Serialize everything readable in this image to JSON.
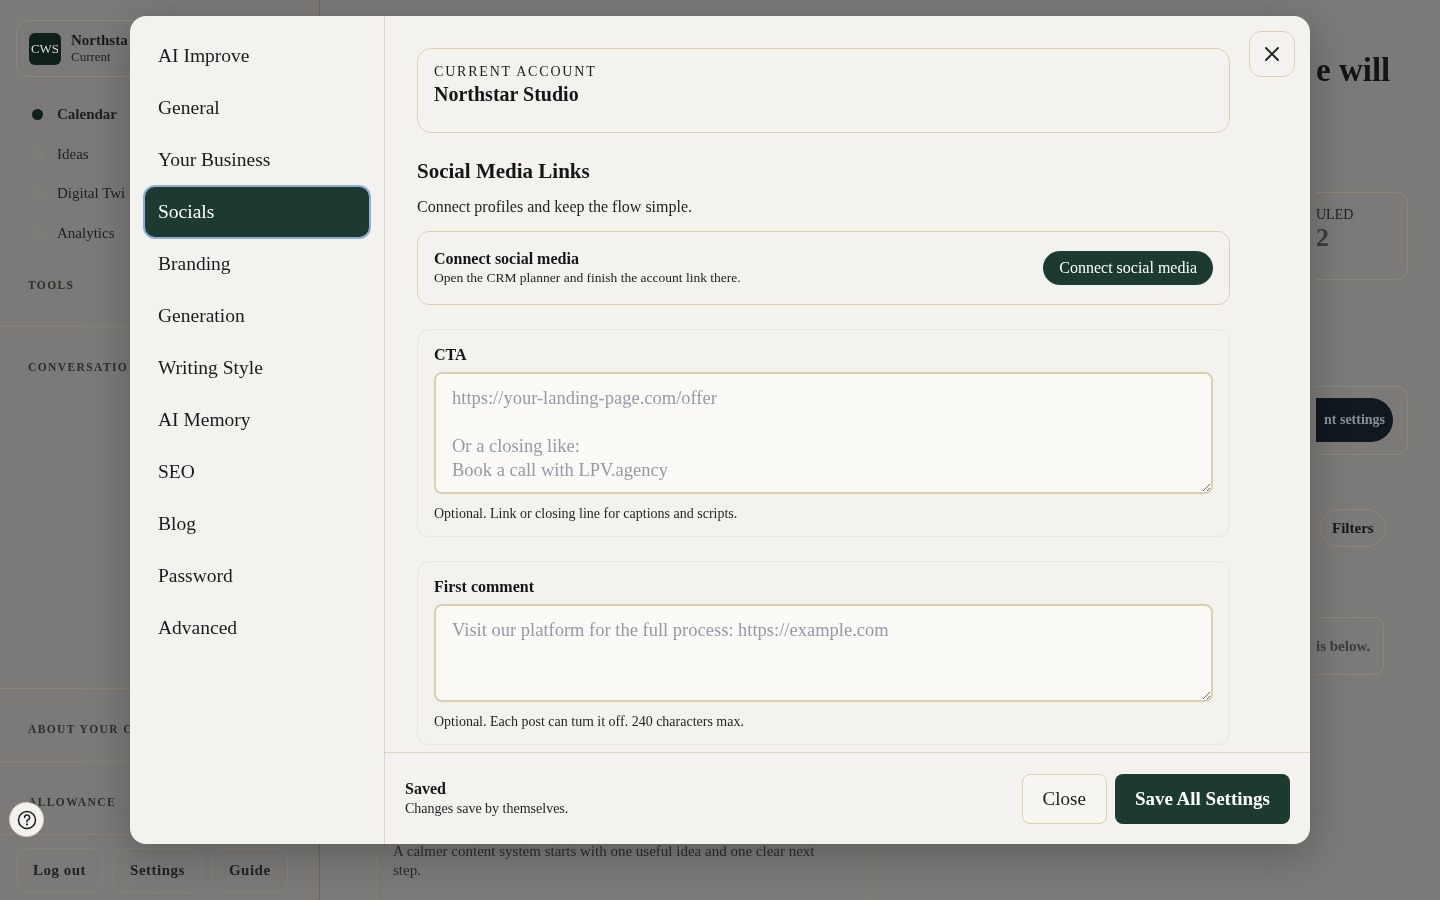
{
  "app_sidebar": {
    "account": {
      "logo": "CWS",
      "name": "Northsta",
      "status": "Current"
    },
    "nav": [
      {
        "label": "Calendar",
        "selected": true
      },
      {
        "label": "Ideas",
        "selected": false
      },
      {
        "label": "Digital Twi",
        "selected": false
      },
      {
        "label": "Analytics",
        "selected": false
      }
    ],
    "sections": [
      "TOOLS",
      "CONVERSATIO",
      "ABOUT YOUR C",
      "ALLOWANCE"
    ],
    "footer_buttons": [
      "Log out",
      "Settings",
      "Guide"
    ]
  },
  "dashboard": {
    "heading_fragment": "e will",
    "stat": {
      "label": "ULED",
      "value": "2"
    },
    "account_button": "nt settings",
    "filters_button": "Filters",
    "notice": "is below.",
    "card_text": "A calmer content system starts with one useful idea and one clear next step."
  },
  "settings_modal": {
    "nav": [
      {
        "label": "AI Improve",
        "selected": false
      },
      {
        "label": "General",
        "selected": false
      },
      {
        "label": "Your Business",
        "selected": false
      },
      {
        "label": "Socials",
        "selected": true
      },
      {
        "label": "Branding",
        "selected": false
      },
      {
        "label": "Generation",
        "selected": false
      },
      {
        "label": "Writing Style",
        "selected": false
      },
      {
        "label": "AI Memory",
        "selected": false
      },
      {
        "label": "SEO",
        "selected": false
      },
      {
        "label": "Blog",
        "selected": false
      },
      {
        "label": "Password",
        "selected": false
      },
      {
        "label": "Advanced",
        "selected": false
      }
    ],
    "account": {
      "label": "CURRENT ACCOUNT",
      "name": "Northstar Studio"
    },
    "section": {
      "title": "Social Media Links",
      "subtitle": "Connect profiles and keep the flow simple."
    },
    "connect": {
      "title": "Connect social media",
      "description": "Open the CRM planner and finish the account link there.",
      "button": "Connect social media"
    },
    "fields": [
      {
        "label": "CTA",
        "placeholder": "https://your-landing-page.com/offer\n\nOr a closing like:\nBook a call with LPV.agency",
        "hint": "Optional. Link or closing line for captions and scripts."
      },
      {
        "label": "First comment",
        "placeholder": "Visit our platform for the full process: https://example.com",
        "hint": "Optional. Each post can turn it off. 240 characters max."
      }
    ],
    "footer": {
      "status": "Saved",
      "note": "Changes save by themselves.",
      "buttons": [
        {
          "label": "Close",
          "kind": "secondary"
        },
        {
          "label": "Save All Settings",
          "kind": "primary"
        }
      ]
    }
  }
}
